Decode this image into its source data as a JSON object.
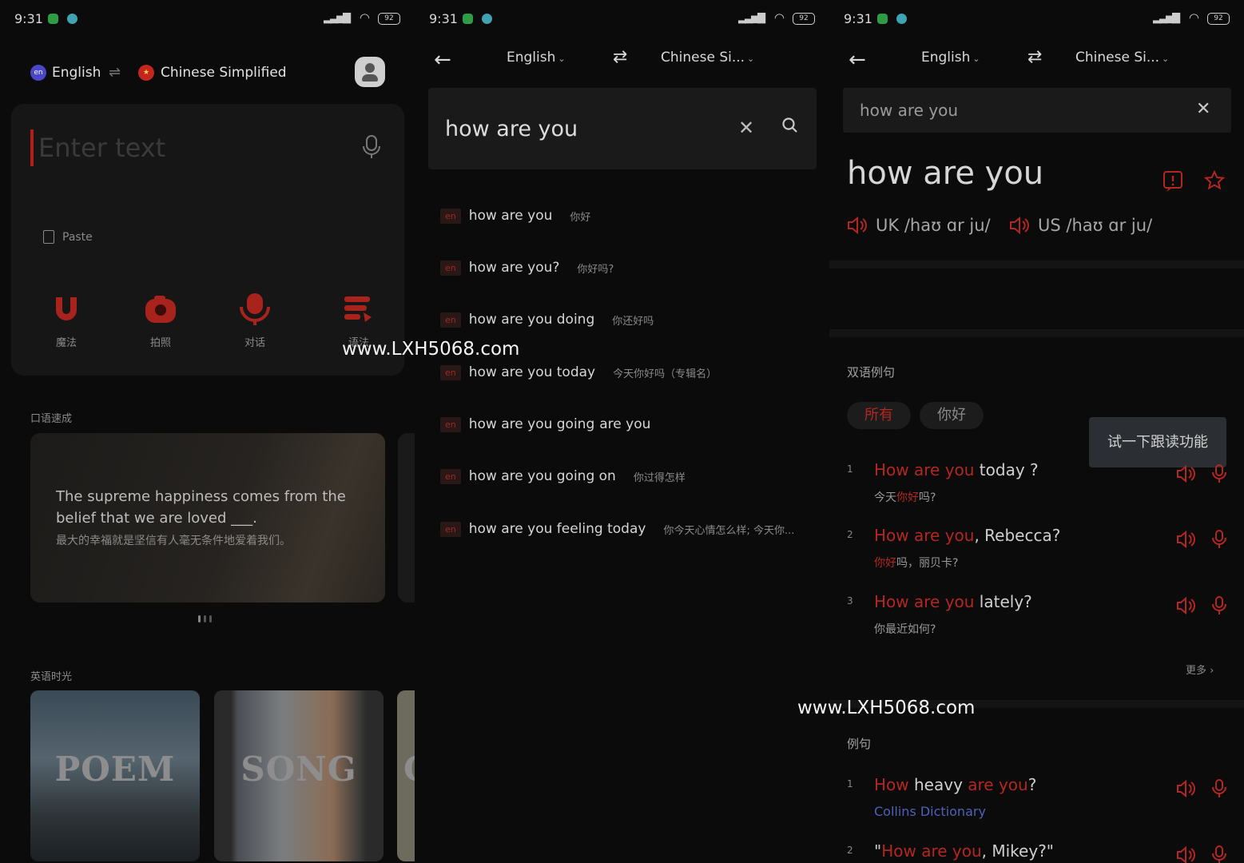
{
  "status_bar": {
    "time": "9:31",
    "battery": "92"
  },
  "home": {
    "source_lang": "English",
    "source_code": "en",
    "target_lang": "Chinese Simplified",
    "input_placeholder": "Enter text",
    "paste_label": "Paste",
    "tools": [
      {
        "label": "魔法",
        "icon": "magnet-icon"
      },
      {
        "label": "拍照",
        "icon": "camera-icon"
      },
      {
        "label": "对话",
        "icon": "microphone-icon"
      },
      {
        "label": "语法",
        "icon": "grammar-icon"
      }
    ],
    "oral_section": "口语速成",
    "quote_en": "The supreme happiness comes from the belief that we are loved ___.",
    "quote_zh": "最大的幸福就是坚信有人毫无条件地爱着我们。",
    "english_time_section": "英语时光",
    "media_cards": [
      "POEM",
      "SONG",
      "C"
    ]
  },
  "search": {
    "source_lang": "English",
    "target_lang": "Chinese Si...",
    "query": "how are you",
    "suggestions": [
      {
        "tag": "en",
        "en": "how are you",
        "zh": "你好"
      },
      {
        "tag": "en",
        "en": "how are you?",
        "zh": "你好吗?"
      },
      {
        "tag": "en",
        "en": "how are you doing",
        "zh": "你还好吗"
      },
      {
        "tag": "en",
        "en": "how are you today",
        "zh": "今天你好吗（专辑名）"
      },
      {
        "tag": "en",
        "en": "how are you going",
        "zh": ""
      },
      {
        "tag": "en",
        "en": "how are you going on",
        "zh": "你过得怎样"
      },
      {
        "tag": "en",
        "en": "how are you feeling today",
        "zh": "你今天心情怎么样; 今天你..."
      }
    ],
    "overlap_text": "are you"
  },
  "result": {
    "source_lang": "English",
    "target_lang": "Chinese Si...",
    "query": "how are you",
    "headword": "how are you",
    "uk_label": "UK",
    "uk_ipa": "/haʊ ɑr ju/",
    "us_label": "US",
    "us_ipa": "/haʊ ɑr ju/",
    "bilingual_title": "双语例句",
    "chip_all": "所有",
    "chip_hello": "你好",
    "tooltip": "试一下跟读功能",
    "examples": [
      {
        "num": "1",
        "hl": "How are you",
        "rest": " today ?",
        "zh_pre": "今天",
        "zh_hl": "你好",
        "zh_post": "吗?"
      },
      {
        "num": "2",
        "hl": "How are you",
        "rest": ", Rebecca?",
        "zh_pre": "",
        "zh_hl": "你好",
        "zh_post": "吗，丽贝卡?"
      },
      {
        "num": "3",
        "hl": "How are you",
        "rest": " lately?",
        "zh_pre": "",
        "zh_hl": "",
        "zh_post": "你最近如何?"
      }
    ],
    "more_label": "更多",
    "example_title": "例句",
    "examples2": [
      {
        "num": "1",
        "a": "How",
        "b": " heavy ",
        "c": "are you",
        "d": "?",
        "source": "Collins Dictionary"
      },
      {
        "num": "2",
        "a": "\"",
        "b": "How are you",
        "c": ", Mikey?\"",
        "d": ""
      }
    ]
  },
  "watermark": "www.LXH5068.com",
  "colors": {
    "accent": "#b3271f",
    "source_blue": "#4a63b8",
    "background": "#0b0b0b"
  }
}
